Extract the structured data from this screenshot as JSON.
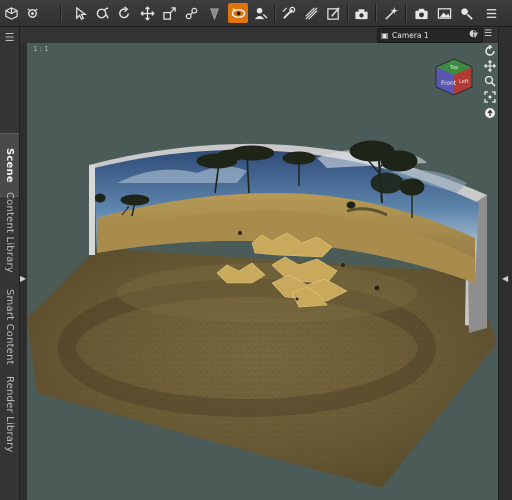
{
  "toolbar": {
    "tools": [
      {
        "name": "new-scene-icon"
      },
      {
        "name": "scene-settings-icon"
      },
      {
        "name": "node-selection-icon"
      },
      {
        "name": "universal-tool-icon"
      },
      {
        "name": "rotate-tool-icon"
      },
      {
        "name": "translate-tool-icon"
      },
      {
        "name": "scale-tool-icon"
      },
      {
        "name": "joint-editor-icon"
      },
      {
        "name": "spot-render-icon"
      },
      {
        "name": "surface-selection-icon"
      },
      {
        "name": "geometry-editor-icon"
      },
      {
        "name": "node-weight-icon"
      },
      {
        "name": "edge-tool-icon"
      },
      {
        "name": "region-tool-icon"
      },
      {
        "name": "render-settings-icon"
      },
      {
        "name": "render-icon"
      },
      {
        "name": "viewport-settings-icon"
      }
    ],
    "active_tool": "surface-selection-icon",
    "accent_color": "#e0730a"
  },
  "left_tabs": [
    {
      "label": "Scene",
      "selected": true
    },
    {
      "label": "Content Library",
      "selected": false
    },
    {
      "label": "Smart Content",
      "selected": false
    },
    {
      "label": "Render Library",
      "selected": false
    }
  ],
  "viewport": {
    "camera_label": "Camera 1",
    "frame_label": "1 : 1",
    "cube_faces": {
      "front": "Front",
      "top": "Top",
      "left": "Left"
    },
    "background_color": "#4b5c58"
  }
}
